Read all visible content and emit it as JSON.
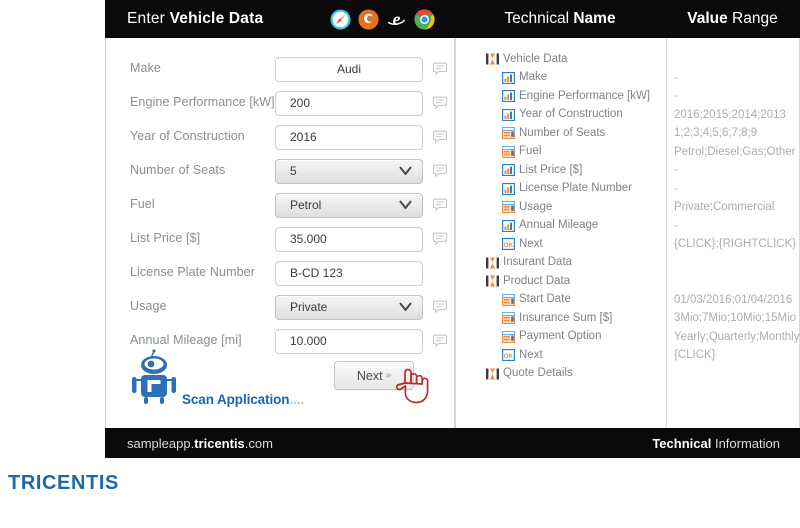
{
  "left": {
    "header": {
      "title_light": "Enter ",
      "title_bold": "Vehicle Data"
    },
    "browser_icons": [
      {
        "name": "safari-icon",
        "color": "#2ec4e6"
      },
      {
        "name": "firefox-icon",
        "color": "#e8701a"
      },
      {
        "name": "internet-explorer-icon",
        "color": "#ffffff"
      },
      {
        "name": "chrome-icon",
        "color": "#f4b400"
      }
    ],
    "fields": [
      {
        "label": "Make",
        "value": "Audi",
        "type": "text",
        "align": "center",
        "bubble": true
      },
      {
        "label": "Engine Performance [kW]",
        "value": "200",
        "type": "text",
        "align": "left",
        "bubble": true
      },
      {
        "label": "Year of Construction",
        "value": "2016",
        "type": "text",
        "align": "left",
        "bubble": true
      },
      {
        "label": "Number of Seats",
        "value": "5",
        "type": "select",
        "align": "left",
        "bubble": true
      },
      {
        "label": "Fuel",
        "value": "Petrol",
        "type": "select",
        "align": "left",
        "bubble": true
      },
      {
        "label": "List Price [$]",
        "value": "35.000",
        "type": "text",
        "align": "left",
        "bubble": true
      },
      {
        "label": "License Plate Number",
        "value": "B-CD 123",
        "type": "text",
        "align": "left",
        "bubble": false
      },
      {
        "label": "Usage",
        "value": "Private",
        "type": "select",
        "align": "left",
        "bubble": true
      },
      {
        "label": "Annual Mileage [mi]",
        "value": "10.000",
        "type": "text",
        "align": "left",
        "bubble": true
      }
    ],
    "scan": {
      "label": "Scan Application",
      "dots": "...."
    },
    "next_button": {
      "label": "Next",
      "chevron": "»"
    },
    "footer": {
      "pre": "sampleapp.",
      "bold": "tricentis",
      "post": ".com"
    }
  },
  "right": {
    "header": {
      "name_light": "Technical ",
      "name_bold": "Name",
      "value_bold": "Value",
      "value_light": " Range"
    },
    "rows": [
      {
        "label": "Vehicle Data",
        "icon": "group-icon",
        "level": 0,
        "value": ""
      },
      {
        "label": "Make",
        "icon": "textfield-icon",
        "level": 1,
        "value": "-"
      },
      {
        "label": "Engine Performance [kW]",
        "icon": "textfield-icon",
        "level": 1,
        "value": "-"
      },
      {
        "label": "Year of Construction",
        "icon": "textfield-icon",
        "level": 1,
        "value": "2016;2015;2014;2013"
      },
      {
        "label": "Number of Seats",
        "icon": "dropdown-icon",
        "level": 1,
        "value": "1;2;3;4;5;6;7;8;9"
      },
      {
        "label": "Fuel",
        "icon": "dropdown-icon",
        "level": 1,
        "value": "Petrol;Diesel;Gas;Other"
      },
      {
        "label": "List Price [$]",
        "icon": "textfield-icon",
        "level": 1,
        "value": "-"
      },
      {
        "label": "License Plate Number",
        "icon": "textfield-icon",
        "level": 1,
        "value": "-"
      },
      {
        "label": "Usage",
        "icon": "dropdown-icon",
        "level": 1,
        "value": "Private;Commercial"
      },
      {
        "label": "Annual Mileage",
        "icon": "textfield-icon",
        "level": 1,
        "value": "-"
      },
      {
        "label": "Next",
        "icon": "okbutton-icon",
        "level": 1,
        "value": "{CLICK};{RIGHTCLICK}"
      },
      {
        "label": "Insurant Data",
        "icon": "group-icon",
        "level": 0,
        "value": ""
      },
      {
        "label": "Product Data",
        "icon": "group-icon",
        "level": 0,
        "value": ""
      },
      {
        "label": "Start Date",
        "icon": "dropdown-icon",
        "level": 1,
        "value": "01/03/2016;01/04/2016"
      },
      {
        "label": "Insurance Sum [$]",
        "icon": "dropdown-icon",
        "level": 1,
        "value": "3Mio;7Mio;10Mio;15Mio"
      },
      {
        "label": "Payment Option",
        "icon": "dropdown-icon",
        "level": 1,
        "value": "Yearly;Quarterly;Monthly"
      },
      {
        "label": "Next",
        "icon": "okbutton-icon",
        "level": 1,
        "value": "{CLICK}"
      },
      {
        "label": "Quote Details",
        "icon": "group-icon",
        "level": 0,
        "value": ""
      }
    ],
    "footer": {
      "bold": "Technical",
      "light": " Information"
    }
  },
  "brand": {
    "logo": "TRICENTIS",
    "color": "#1f66b0"
  }
}
